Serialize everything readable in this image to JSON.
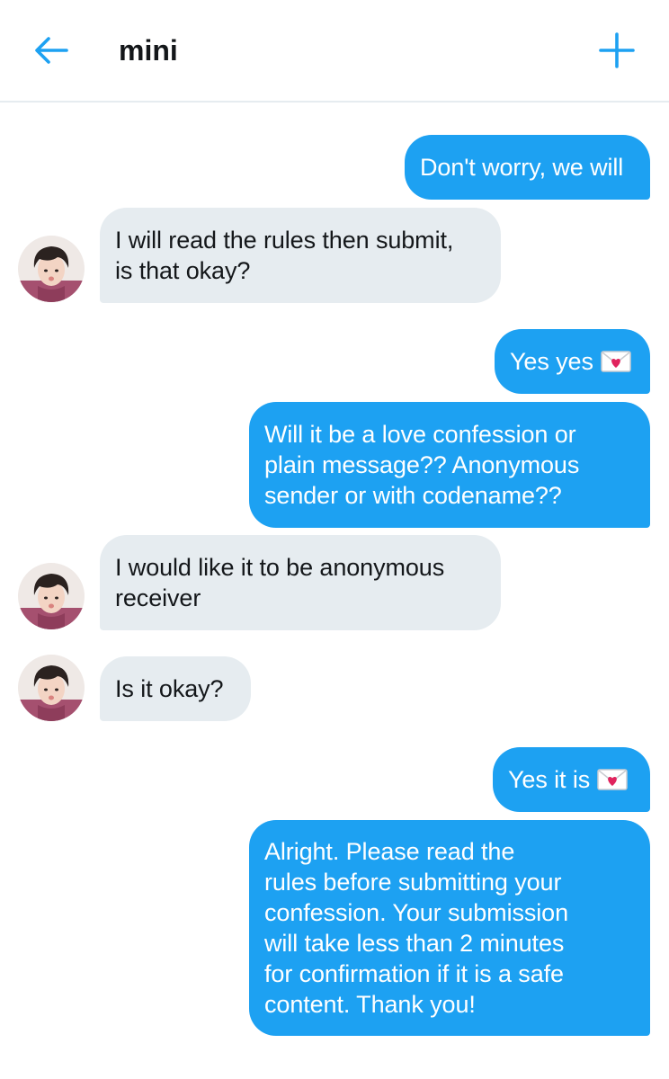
{
  "header": {
    "title": "mini",
    "back_icon": "arrow-left-icon",
    "add_icon": "plus-icon",
    "accent": "#1da1f2"
  },
  "colors": {
    "sent_bubble": "#1da1f2",
    "received_bubble": "#e6ecf0",
    "sent_text": "#ffffff",
    "received_text": "#14171a"
  },
  "messages": [
    {
      "direction": "sent",
      "text": "Don't worry, we will"
    },
    {
      "direction": "received",
      "text": "I will read the rules then submit,\nis that okay?"
    },
    {
      "direction": "sent",
      "text": "Yes yes",
      "emoji": "love-letter-icon"
    },
    {
      "direction": "sent",
      "text": "Will it be a love confession or\nplain message?? Anonymous\nsender or with codename??"
    },
    {
      "direction": "received",
      "text": "I would like it to be anonymous\nreceiver"
    },
    {
      "direction": "received",
      "text": "Is it okay?"
    },
    {
      "direction": "sent",
      "text": "Yes it is",
      "emoji": "love-letter-icon"
    },
    {
      "direction": "sent",
      "text": "Alright. Please read the\nrules before submitting your\nconfession. Your submission\nwill take less than 2 minutes\nfor confirmation if it is a safe\ncontent. Thank you!"
    }
  ]
}
